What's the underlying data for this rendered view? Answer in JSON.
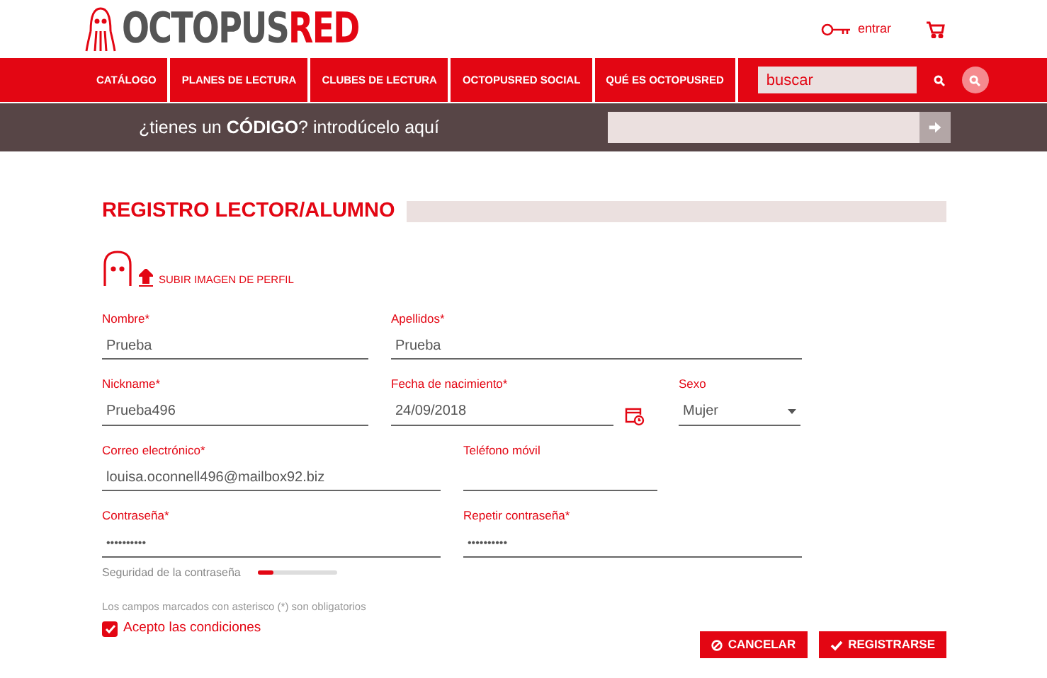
{
  "header": {
    "logo": [
      "OCTOPUS",
      "RED"
    ],
    "login": "entrar"
  },
  "nav": {
    "items": [
      "CATÁLOGO",
      "PLANES DE LECTURA",
      "CLUBES DE LECTURA",
      "OCTOPUSRED SOCIAL",
      "QUÉ ES OCTOPUSRED"
    ],
    "search": {
      "placeholder": "buscar"
    }
  },
  "code_bar": {
    "text": "¿tienes un **CÓDIGO**? introdúcelo aquí"
  },
  "form": {
    "title": "REGISTRO LECTOR/ALUMNO",
    "upload": "SUBIR IMAGEN DE PERFIL",
    "rows": [
      [
        {
          "kind": "text",
          "label": "Nombre*",
          "value": "Prueba"
        },
        {
          "kind": "text",
          "label": "Apellidos*",
          "value": "Prueba"
        }
      ],
      [
        {
          "kind": "text",
          "label": "Nickname*",
          "value": "Prueba496"
        },
        {
          "kind": "date",
          "label": "Fecha de nacimiento*",
          "value": "24/09/2018"
        },
        {
          "kind": "select",
          "label": "Sexo",
          "value": "Mujer"
        }
      ],
      [
        {
          "kind": "text",
          "label": "Correo electrónico*",
          "value": "louisa.oconnell496@mailbox92.biz"
        },
        {
          "kind": "text",
          "label": "Teléfono móvil"
        }
      ],
      [
        {
          "kind": "password",
          "label": "Contraseña*",
          "value": "••••••••••"
        },
        {
          "kind": "password",
          "label": "Repetir contraseña*",
          "value": "••••••••••"
        }
      ]
    ],
    "strength": {
      "label": "Seguridad de la contraseña",
      "level": 0.2
    },
    "note": "Los campos marcados con asterisco (*) son obligatorios",
    "terms": {
      "label": "Acepto las condiciones",
      "checked": true
    },
    "buttons": [
      {
        "kind": "cancel",
        "label": "CANCELAR"
      },
      {
        "kind": "submit",
        "label": "REGISTRARSE"
      }
    ]
  }
}
